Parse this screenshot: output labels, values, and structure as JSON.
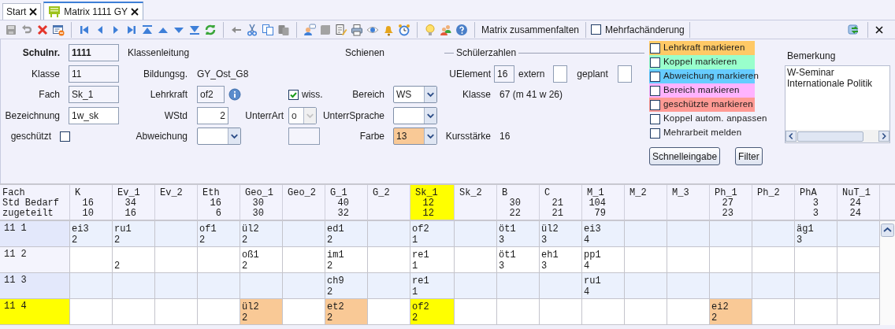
{
  "tabs": [
    {
      "label": "Start",
      "selected": false
    },
    {
      "label": "Matrix 1111 GY",
      "selected": true
    }
  ],
  "toolbar": {
    "collapse_button": "Matrix zusammenfalten",
    "multi_change": {
      "label": "Mehrfachänderung",
      "checked": false
    }
  },
  "form": {
    "schulnr": {
      "label": "Schulnr.",
      "value": "1111"
    },
    "klasse": {
      "label": "Klasse",
      "value": "11"
    },
    "fach": {
      "label": "Fach",
      "value": "Sk_1"
    },
    "bezeichnung": {
      "label": "Bezeichnung",
      "value": "1w_sk"
    },
    "geschuetzt": {
      "label": "geschützt",
      "checked": false
    },
    "klassenleitung": {
      "label": "Klassenleitung"
    },
    "bildungsgang": {
      "label": "Bildungsg.",
      "value": "GY_Ost_G8"
    },
    "lehrkraft": {
      "label": "Lehrkraft",
      "value": "of2"
    },
    "wstd": {
      "label": "WStd",
      "value": "2"
    },
    "abweichung": {
      "label": "Abweichung"
    },
    "unterrart": {
      "label": "UnterrArt",
      "value": "o",
      "disabled": true
    },
    "wiss": {
      "label": "wiss.",
      "checked": true
    },
    "schienen": {
      "label": "Schienen"
    },
    "bereich": {
      "label": "Bereich",
      "value": "WS"
    },
    "unterrsprache": {
      "label": "UnterrSprache"
    },
    "farbe": {
      "label": "Farbe",
      "value": "13",
      "color": "#f9c996"
    }
  },
  "schuelerzahlen": {
    "title": "Schülerzahlen",
    "uelement": {
      "label": "UElement",
      "value": "16"
    },
    "extern": {
      "label": "extern"
    },
    "geplant": {
      "label": "geplant"
    },
    "klasse": {
      "label": "Klasse",
      "value": "67 (m 41 w 26)"
    },
    "kursstaerke": {
      "label": "Kursstärke",
      "value": "16"
    }
  },
  "marks": [
    {
      "label": "Lehrkraft markieren",
      "checked": false,
      "color": "#ffc966"
    },
    {
      "label": "Koppel markieren",
      "checked": false,
      "color": "#99ffcc"
    },
    {
      "label": "Abweichung markieren",
      "checked": false,
      "color": "#66ccff"
    },
    {
      "label": "Bereich markieren",
      "checked": false,
      "color": "#ffb3ff"
    },
    {
      "label": "geschützte markieren",
      "checked": false,
      "color": "#ff9a94"
    },
    {
      "label": "Koppel autom. anpassen",
      "checked": false
    },
    {
      "label": "Mehrarbeit melden",
      "checked": false
    }
  ],
  "buttons": [
    "Schnelleingabe",
    "Filter"
  ],
  "bemerkung": {
    "label": "Bemerkung",
    "lines": [
      "W-Seminar",
      "Internationale Politik"
    ]
  },
  "matrix": {
    "header_labels": [
      "Fach",
      "Std Bedarf",
      "zugeteilt"
    ],
    "columns": [
      {
        "name": "K",
        "bedarf": "16",
        "zugeteilt": "10",
        "selected": false
      },
      {
        "name": "Ev_1",
        "bedarf": "34",
        "zugeteilt": "16",
        "selected": false
      },
      {
        "name": "Ev_2",
        "selected": false
      },
      {
        "name": "Eth",
        "bedarf": "16",
        "zugeteilt": "6",
        "selected": false
      },
      {
        "name": "Geo_1",
        "bedarf": "30",
        "zugeteilt": "30",
        "selected": false
      },
      {
        "name": "Geo_2",
        "selected": false
      },
      {
        "name": "G_1",
        "bedarf": "40",
        "zugeteilt": "32",
        "selected": false
      },
      {
        "name": "G_2",
        "selected": false
      },
      {
        "name": "Sk_1",
        "bedarf": "12",
        "zugeteilt": "12",
        "selected": true
      },
      {
        "name": "Sk_2",
        "selected": false
      },
      {
        "name": "B",
        "bedarf": "30",
        "zugeteilt": "22",
        "selected": false
      },
      {
        "name": "C",
        "bedarf": "21",
        "zugeteilt": "21",
        "selected": false
      },
      {
        "name": "M_1",
        "bedarf": "104",
        "zugeteilt": "79",
        "selected": false
      },
      {
        "name": "M_2",
        "selected": false
      },
      {
        "name": "M_3",
        "selected": false
      },
      {
        "name": "Ph_1",
        "bedarf": "27",
        "zugeteilt": "23",
        "selected": false
      },
      {
        "name": "Ph_2",
        "selected": false
      },
      {
        "name": "PhA",
        "bedarf": "3",
        "zugeteilt": "3",
        "selected": false
      },
      {
        "name": "NuT_1",
        "bedarf": "24",
        "zugeteilt": "24",
        "selected": false
      }
    ],
    "rows": [
      {
        "label": "11 1",
        "selected": false,
        "cells": [
          {
            "teacher": "ei3",
            "hours": "2"
          },
          {
            "teacher": "ru1",
            "hours": "2"
          },
          {},
          {
            "teacher": "of1",
            "hours": "2"
          },
          {
            "teacher": "ül2",
            "hours": "2"
          },
          {},
          {
            "teacher": "ed1",
            "hours": "2"
          },
          {},
          {
            "teacher": "of2",
            "hours": "1"
          },
          {},
          {
            "teacher": "öt1",
            "hours": "3"
          },
          {
            "teacher": "ül2",
            "hours": "3"
          },
          {
            "teacher": "ei3",
            "hours": "4"
          },
          {},
          {},
          {},
          {},
          {
            "teacher": "äg1",
            "hours": "3"
          },
          {}
        ]
      },
      {
        "label": "11 2",
        "selected": false,
        "cells": [
          {},
          {
            "hours": "2"
          },
          {},
          {},
          {
            "teacher": "oß1",
            "hours": "2"
          },
          {},
          {
            "teacher": "im1",
            "hours": "2"
          },
          {},
          {
            "teacher": "re1",
            "hours": "1"
          },
          {},
          {
            "teacher": "öt1",
            "hours": "3"
          },
          {
            "teacher": "eh1",
            "hours": "3"
          },
          {
            "teacher": "pp1",
            "hours": "4"
          },
          {},
          {},
          {},
          {},
          {},
          {}
        ]
      },
      {
        "label": "11 3",
        "selected": false,
        "cells": [
          {},
          {},
          {},
          {},
          {},
          {},
          {
            "teacher": "ch9",
            "hours": "2"
          },
          {},
          {
            "teacher": "re1",
            "hours": "1"
          },
          {},
          {},
          {},
          {
            "teacher": "ru1",
            "hours": "4"
          },
          {},
          {},
          {},
          {},
          {},
          {}
        ]
      },
      {
        "label": "11 4",
        "selected": true,
        "cells": [
          {},
          {},
          {},
          {},
          {
            "teacher": "ül2",
            "hours": "2",
            "color": "#f9c996"
          },
          {},
          {
            "teacher": "et2",
            "hours": "2",
            "color": "#f9c996"
          },
          {},
          {
            "teacher": "of2",
            "hours": "2"
          },
          {},
          {},
          {},
          {},
          {},
          {},
          {
            "teacher": "ei2",
            "hours": "2",
            "color": "#f9c996"
          },
          {},
          {},
          {}
        ]
      }
    ]
  }
}
